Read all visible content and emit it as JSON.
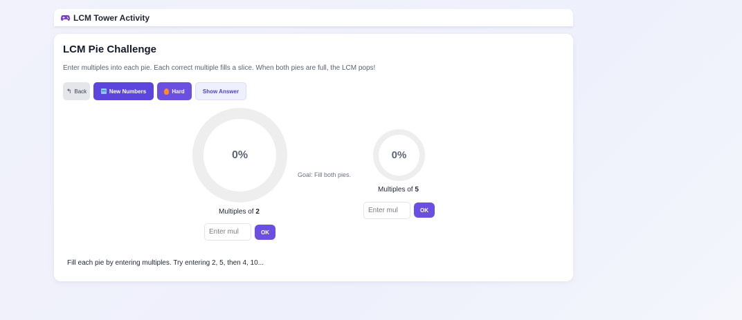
{
  "header": {
    "icon": "gamepad-icon",
    "title": "LCM Tower Activity"
  },
  "challenge": {
    "title": "LCM Pie Challenge",
    "instructions": "Enter multiples into each pie. Each correct multiple fills a slice. When both pies are full, the LCM pops!"
  },
  "toolbar": {
    "back_label": "Back",
    "new_numbers_label": "New Numbers",
    "hard_label": "Hard",
    "show_answer_label": "Show Answer"
  },
  "pies": [
    {
      "percent_text": "0%",
      "fill_fraction": 0,
      "label_prefix": "Multiples of ",
      "number": "2",
      "input_placeholder": "Enter mul",
      "ok_label": "OK"
    },
    {
      "percent_text": "0%",
      "fill_fraction": 0,
      "label_prefix": "Multiples of ",
      "number": "5",
      "input_placeholder": "Enter mul",
      "ok_label": "OK"
    }
  ],
  "goal_text": "Goal: Fill both pies.",
  "status_text": "Fill each pie by entering multiples. Try entering 2, 5, then 4, 10...",
  "colors": {
    "accent": "#6b4fe0",
    "accent_dark": "#5b45dd",
    "pie_track": "#eeeeee"
  }
}
